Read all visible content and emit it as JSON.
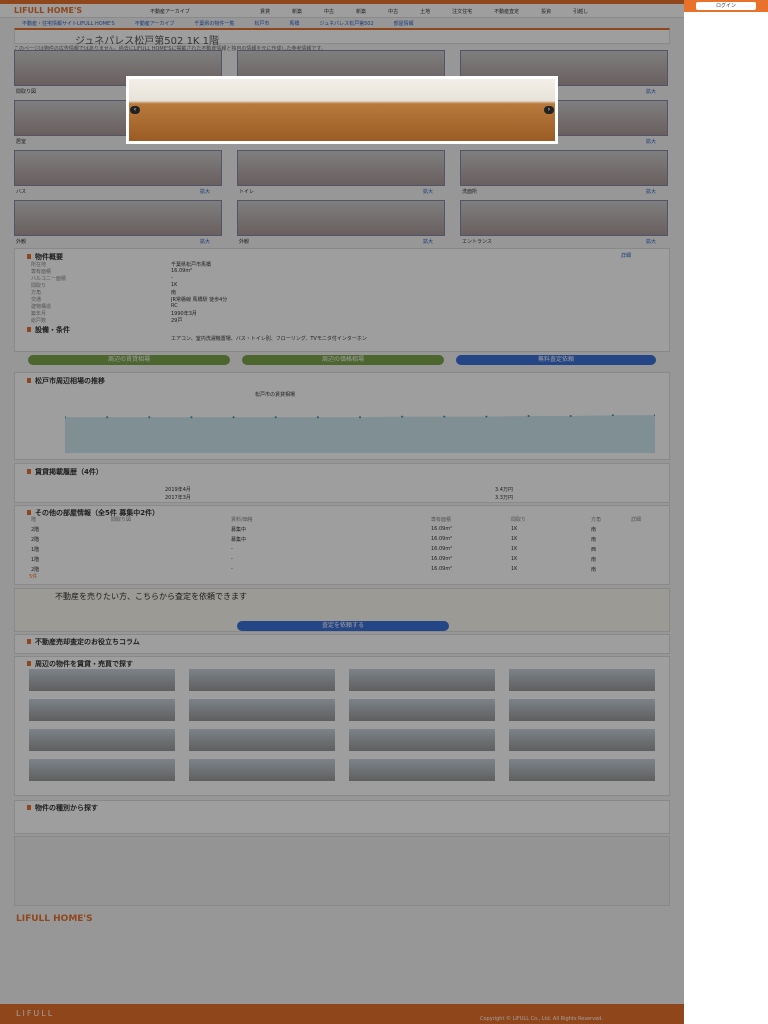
{
  "header": {
    "brand": "LIFULL HOME'S",
    "category": "不動産アーカイブ",
    "nav": [
      "賃貸",
      "新築",
      "中古",
      "新築",
      "中古",
      "土地",
      "注文住宅",
      "不動産査定",
      "投資",
      "引越し"
    ],
    "side_label": "ログイン"
  },
  "breadcrumb": [
    "不動産・住宅情報サイトLIFULL HOME'S",
    "不動産アーカイブ",
    "千葉県の物件一覧",
    "松戸市",
    "馬橋",
    "ジュネパレス松戸第502",
    "部屋情報"
  ],
  "title": "ジュネパレス松戸第502 1K 1階",
  "notice": "このページは物件の広告情報ではありません。過去にLIFULL HOME'Sに掲載された不動産情報と独自の情報を元に作成した参考情報です。",
  "photos": {
    "labels": [
      "間取り図",
      "居室",
      "居室",
      "居室",
      "キッチン",
      "玄関",
      "バス",
      "トイレ",
      "洗面所",
      "外観",
      "外観",
      "エントランス"
    ],
    "more": "拡大"
  },
  "lightbox": {
    "prev": "‹",
    "next": "›"
  },
  "overview": {
    "heading": "物件概要",
    "more": "詳細",
    "rows": [
      [
        "所在地",
        "千葉県松戸市馬橋"
      ],
      [
        "専有面積",
        "16.09m²"
      ],
      [
        "バルコニー面積",
        "-"
      ],
      [
        "間取り",
        "1K"
      ],
      [
        "方角",
        "南"
      ],
      [
        "交通",
        "JR常磐線 馬橋駅 徒歩4分"
      ],
      [
        "建物構造",
        "RC"
      ],
      [
        "築年月",
        "1990年3月"
      ],
      [
        "総戸数",
        "29戸"
      ]
    ]
  },
  "features": {
    "heading": "設備・条件",
    "more": "詳細",
    "text": "エアコン、室内洗濯機置場、バス・トイレ別、フローリング、TVモニタ付インターホン"
  },
  "buttons": {
    "rent": "周辺の賃貸相場",
    "sale": "周辺の価格相場",
    "assess": "無料査定依頼"
  },
  "chart_section": {
    "heading": "松戸市周辺相場の推移",
    "legend": "松戸市の賃貸相場"
  },
  "chart_data": {
    "type": "area",
    "title": "松戸市周辺相場の推移",
    "series": [
      {
        "name": "松戸市の賃貸相場",
        "values": [
          5.5,
          5.5,
          5.5,
          5.5,
          5.5,
          5.5,
          5.5,
          5.5,
          5.6,
          5.6,
          5.6,
          5.7,
          5.7,
          5.8,
          5.8
        ]
      }
    ],
    "ylim": [
      0,
      8
    ]
  },
  "history": {
    "heading": "賃貸掲載履歴（4件）",
    "rows": [
      [
        "2019年4月",
        "3.4万円"
      ],
      [
        "2017年3月",
        "3.3万円"
      ]
    ]
  },
  "rooms": {
    "heading": "その他の部屋情報（全5件 募集中2件）",
    "columns": [
      "階",
      "間取り図",
      "賃料/価格",
      "専有面積",
      "間取り",
      "方角",
      "詳細"
    ],
    "rows": [
      [
        "2階",
        "募集中",
        "16.09m²",
        "1K",
        "南"
      ],
      [
        "2階",
        "募集中",
        "16.09m²",
        "1K",
        "南"
      ],
      [
        "1階",
        "-",
        "16.09m²",
        "1K",
        "西"
      ],
      [
        "1階",
        "-",
        "16.09m²",
        "1K",
        "南"
      ],
      [
        "2階",
        "-",
        "16.09m²",
        "1K",
        "南"
      ]
    ],
    "count": "5件"
  },
  "sell": {
    "heading": "不動産を売りたい方、こちらから査定を依頼できます",
    "button": "査定を依頼する"
  },
  "column": {
    "heading": "不動産売却査定のお役立ちコラム"
  },
  "nearby": {
    "heading": "周辺の物件を賃貸・売買で探す"
  },
  "search": {
    "heading": "物件の種別から探す"
  },
  "footer": {
    "brand": "LIFULL HOME'S",
    "lifull": "LIFULL",
    "copyright": "Copyright © LIFULL Co., Ltd. All Rights Reserved."
  }
}
